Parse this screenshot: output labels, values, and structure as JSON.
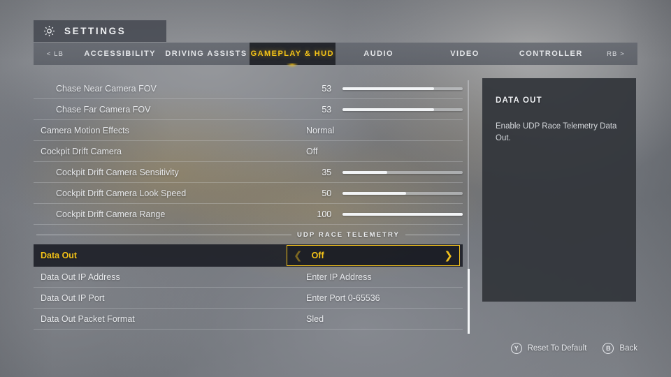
{
  "header": {
    "title": "SETTINGS",
    "gear_icon": "gear-icon"
  },
  "tabbar": {
    "prev_hint": "< LB",
    "next_hint": "RB >",
    "tabs": [
      {
        "label": "ACCESSIBILITY",
        "active": false
      },
      {
        "label": "DRIVING ASSISTS",
        "active": false
      },
      {
        "label": "GAMEPLAY & HUD",
        "active": true
      },
      {
        "label": "AUDIO",
        "active": false
      },
      {
        "label": "VIDEO",
        "active": false
      },
      {
        "label": "CONTROLLER",
        "active": false
      }
    ],
    "active_color": "#f3c218"
  },
  "settings": {
    "rows": [
      {
        "kind": "slider",
        "label": "Chase Near Camera FOV",
        "indent": true,
        "value": "53",
        "fill_pct": 76
      },
      {
        "kind": "slider",
        "label": "Chase Far Camera FOV",
        "indent": true,
        "value": "53",
        "fill_pct": 76
      },
      {
        "kind": "text",
        "label": "Camera Motion Effects",
        "indent": false,
        "value": "Normal"
      },
      {
        "kind": "text",
        "label": "Cockpit Drift Camera",
        "indent": false,
        "value": "Off"
      },
      {
        "kind": "slider",
        "label": "Cockpit Drift Camera Sensitivity",
        "indent": true,
        "value": "35",
        "fill_pct": 37
      },
      {
        "kind": "slider",
        "label": "Cockpit Drift Camera Look Speed",
        "indent": true,
        "value": "50",
        "fill_pct": 53
      },
      {
        "kind": "slider",
        "label": "Cockpit Drift Camera Range",
        "indent": true,
        "value": "100",
        "fill_pct": 100
      }
    ],
    "section": {
      "title": "UDP RACE TELEMETRY"
    },
    "selected_row": {
      "label": "Data Out",
      "value": "Off",
      "left_chevron": "chevron-left-icon",
      "right_chevron": "chevron-right-icon"
    },
    "telemetry_rows": [
      {
        "kind": "text",
        "label": "Data Out IP Address",
        "indent": false,
        "value": "Enter IP Address"
      },
      {
        "kind": "text",
        "label": "Data Out IP Port",
        "indent": false,
        "value": "Enter Port 0-65536"
      },
      {
        "kind": "text",
        "label": "Data Out Packet Format",
        "indent": false,
        "value": "Sled"
      }
    ]
  },
  "panel": {
    "title": "DATA OUT",
    "description": "Enable UDP Race Telemetry Data Out."
  },
  "footer": {
    "prompts": [
      {
        "button": "Y",
        "label": "Reset To Default"
      },
      {
        "button": "B",
        "label": "Back"
      }
    ]
  }
}
